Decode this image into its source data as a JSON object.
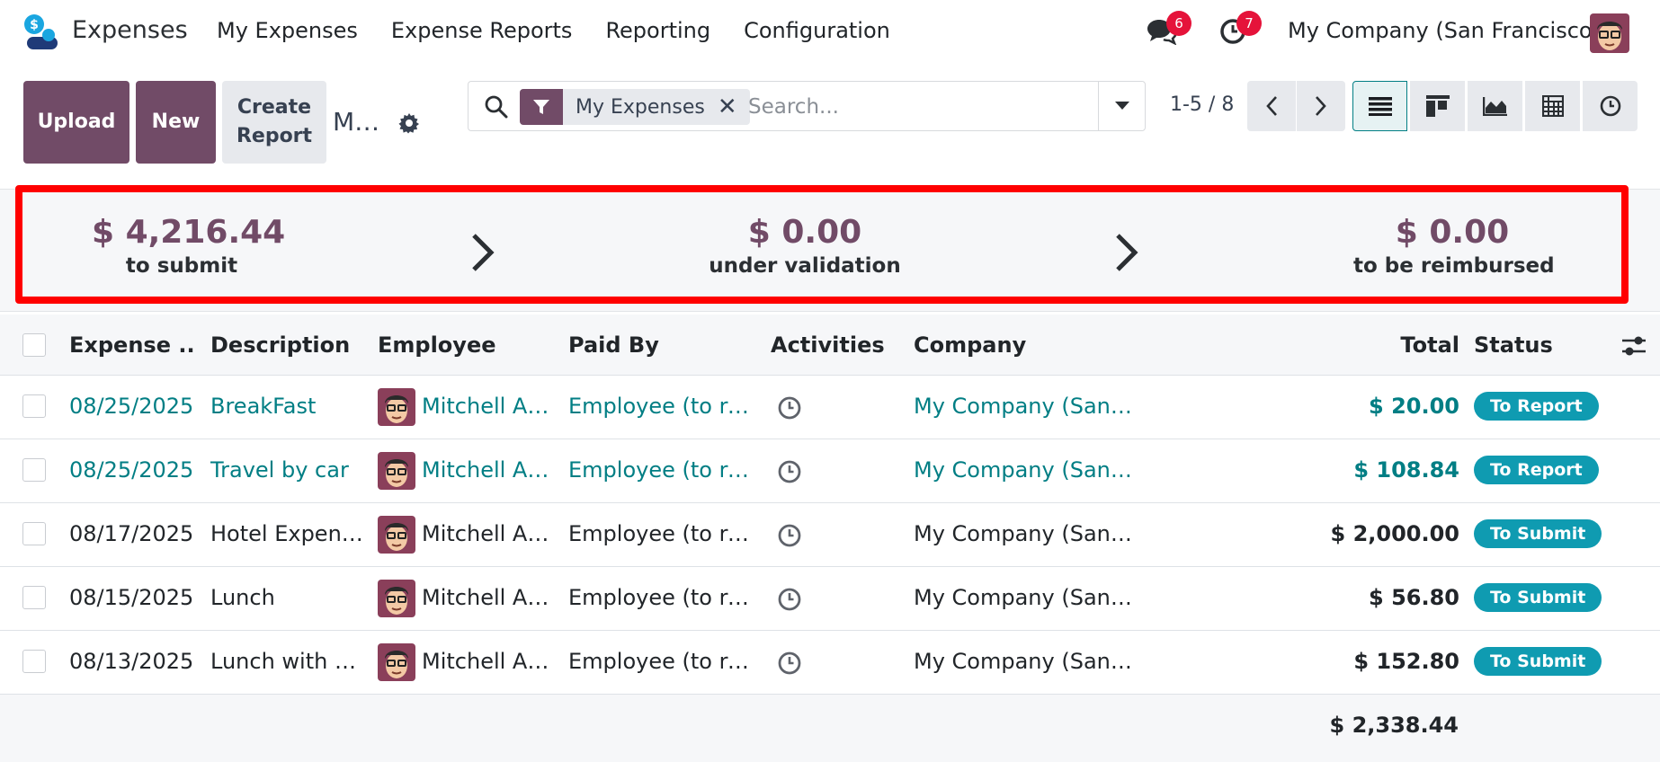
{
  "app": {
    "name": "Expenses",
    "logo": "expenses-app-logo"
  },
  "nav": {
    "menu": [
      "My Expenses",
      "Expense Reports",
      "Reporting",
      "Configuration"
    ],
    "messages_badge": "6",
    "activities_badge": "7",
    "company": "My Company (San Francisco)"
  },
  "toolbar": {
    "upload_label": "Upload",
    "new_label": "New",
    "create_report_label": "Create Report",
    "breadcrumb": "M…"
  },
  "search": {
    "facet": "My Expenses",
    "placeholder": "Search...",
    "value": ""
  },
  "pager": {
    "value": "1-5 / 8"
  },
  "views": [
    "list-view",
    "kanban-view",
    "graph-view",
    "pivot-view",
    "activity-view"
  ],
  "active_view": "list-view",
  "summary": {
    "blocks": [
      {
        "amount": "$ 4,216.44",
        "label": "to submit"
      },
      {
        "amount": "$ 0.00",
        "label": "under validation"
      },
      {
        "amount": "$ 0.00",
        "label": "to be reimbursed"
      }
    ]
  },
  "table": {
    "columns": [
      "Expense ...",
      "Description",
      "Employee",
      "Paid By",
      "Activities",
      "Company",
      "Total",
      "Status"
    ],
    "rows": [
      {
        "date": "08/25/2025",
        "description": "BreakFast",
        "employee": "Mitchell A…",
        "paid_by": "Employee (to rei…",
        "company": "My Company (San F…",
        "total": "$ 20.00",
        "status": "To Report",
        "style": "link"
      },
      {
        "date": "08/25/2025",
        "description": "Travel by car",
        "employee": "Mitchell A…",
        "paid_by": "Employee (to rei…",
        "company": "My Company (San F…",
        "total": "$ 108.84",
        "status": "To Report",
        "style": "link"
      },
      {
        "date": "08/17/2025",
        "description": "Hotel Expen…",
        "employee": "Mitchell A…",
        "paid_by": "Employee (to rei…",
        "company": "My Company (San F…",
        "total": "$ 2,000.00",
        "status": "To Submit",
        "style": "plain"
      },
      {
        "date": "08/15/2025",
        "description": "Lunch",
        "employee": "Mitchell A…",
        "paid_by": "Employee (to rei…",
        "company": "My Company (San F…",
        "total": "$ 56.80",
        "status": "To Submit",
        "style": "plain"
      },
      {
        "date": "08/13/2025",
        "description": "Lunch with C…",
        "employee": "Mitchell A…",
        "paid_by": "Employee (to rei…",
        "company": "My Company (San F…",
        "total": "$ 152.80",
        "status": "To Submit",
        "style": "plain"
      }
    ],
    "grand_total": "$ 2,338.44"
  },
  "colors": {
    "primary": "#714b67",
    "link": "#017e84",
    "status_pill": "#0f9bb1",
    "badge": "#e5133a",
    "highlight": "#ff0000"
  }
}
